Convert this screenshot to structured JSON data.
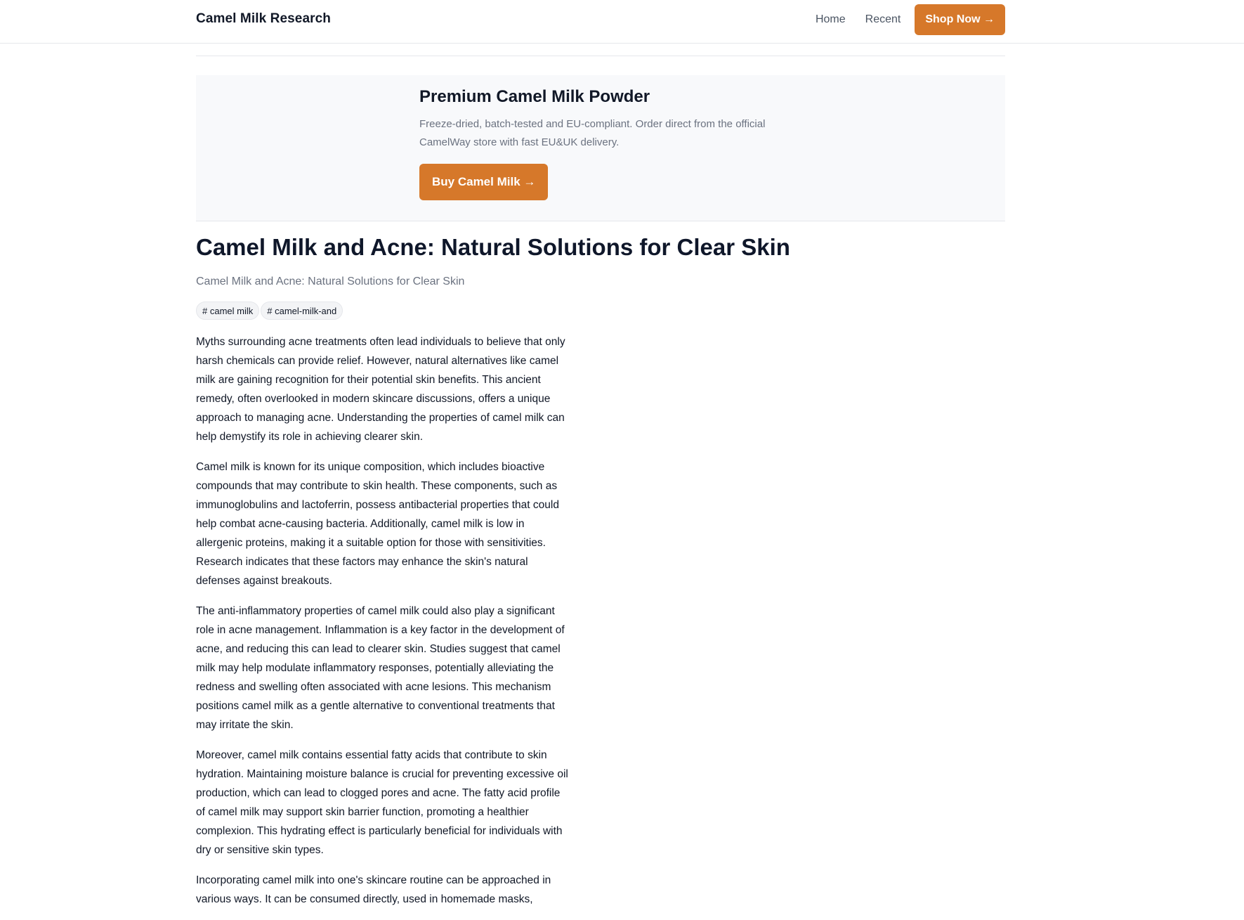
{
  "header": {
    "brand": "Camel Milk Research",
    "nav": [
      "Home",
      "Recent"
    ],
    "shop_button": "Shop Now →"
  },
  "promo": {
    "title": "Premium Camel Milk Powder",
    "text": "Freeze-dried, batch-tested and EU-compliant. Order direct from the official CamelWay store with fast EU&UK delivery.",
    "button": "Buy Camel Milk →"
  },
  "article": {
    "title": "Camel Milk and Acne: Natural Solutions for Clear Skin",
    "subtitle": "Camel Milk and Acne: Natural Solutions for Clear Skin",
    "tags": [
      "# camel milk",
      "# camel-milk-and"
    ],
    "paragraphs": [
      "Myths surrounding acne treatments often lead individuals to believe that only harsh chemicals can provide relief. However, natural alternatives like camel milk are gaining recognition for their potential skin benefits. This ancient remedy, often overlooked in modern skincare discussions, offers a unique approach to managing acne. Understanding the properties of camel milk can help demystify its role in achieving clearer skin.",
      "Camel milk is known for its unique composition, which includes bioactive compounds that may contribute to skin health. These components, such as immunoglobulins and lactoferrin, possess antibacterial properties that could help combat acne-causing bacteria. Additionally, camel milk is low in allergenic proteins, making it a suitable option for those with sensitivities. Research indicates that these factors may enhance the skin's natural defenses against breakouts.",
      "The anti-inflammatory properties of camel milk could also play a significant role in acne management. Inflammation is a key factor in the development of acne, and reducing this can lead to clearer skin. Studies suggest that camel milk may help modulate inflammatory responses, potentially alleviating the redness and swelling often associated with acne lesions. This mechanism positions camel milk as a gentle alternative to conventional treatments that may irritate the skin.",
      "Moreover, camel milk contains essential fatty acids that contribute to skin hydration. Maintaining moisture balance is crucial for preventing excessive oil production, which can lead to clogged pores and acne. The fatty acid profile of camel milk may support skin barrier function, promoting a healthier complexion. This hydrating effect is particularly beneficial for individuals with dry or sensitive skin types.",
      "Incorporating camel milk into one's skincare routine can be approached in various ways. It can be consumed directly, used in homemade masks,"
    ]
  },
  "colors": {
    "accent": "#d6782a",
    "text": "#111827",
    "muted": "#6b7280",
    "promo_bg": "#f8f9fb"
  }
}
